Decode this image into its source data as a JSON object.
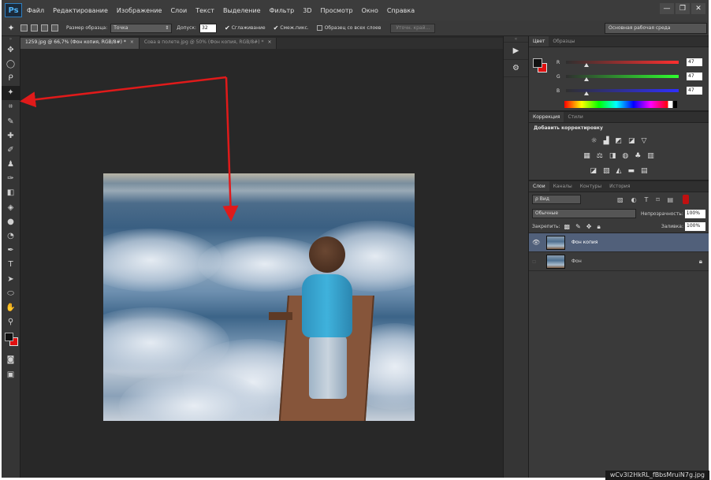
{
  "app": {
    "logo": "Ps",
    "menu": [
      "Файл",
      "Редактирование",
      "Изображение",
      "Слои",
      "Текст",
      "Выделение",
      "Фильтр",
      "3D",
      "Просмотр",
      "Окно",
      "Справка"
    ],
    "window_controls": {
      "minimize": "—",
      "restore": "❐",
      "close": "✕"
    }
  },
  "options_bar": {
    "tool_icon": "magic-wand-icon",
    "sample_size_label": "Размер образца:",
    "sample_size_value": "Точка",
    "tolerance_label": "Допуск:",
    "tolerance_value": "32",
    "antialias_label": "Сглаживание",
    "contiguous_label": "Смеж.пикс.",
    "all_layers_label": "Образец со всех слоев",
    "refine_edge_label": "Уточн. край...",
    "workspace_label": "Основная рабочая среда"
  },
  "doc_tabs": [
    {
      "label": "1259.jpg @ 66,7% (Фон копия, RGB/8#) *",
      "active": true
    },
    {
      "label": "Сова в полете.jpg @ 50% (Фон копия, RGB/8#) *",
      "active": false
    }
  ],
  "colors": {
    "foreground": "#111111",
    "background": "#e01010",
    "arrow": "#e01a1a"
  },
  "color_panel": {
    "tabs": [
      "Цвет",
      "Образцы"
    ],
    "sliders": [
      {
        "label": "R",
        "value": "47",
        "fraction": 0.18
      },
      {
        "label": "G",
        "value": "47",
        "fraction": 0.18
      },
      {
        "label": "B",
        "value": "47",
        "fraction": 0.18
      }
    ]
  },
  "adjustments_panel": {
    "tabs": [
      "Коррекция",
      "Стили"
    ],
    "title": "Добавить корректировку"
  },
  "layers_panel": {
    "tabs": [
      "Слои",
      "Каналы",
      "Контуры",
      "История"
    ],
    "kind_label": "ρ Вид",
    "blend_mode": "Обычные",
    "opacity_label": "Непрозрачность:",
    "opacity_value": "100%",
    "lock_label": "Закрепить:",
    "fill_label": "Заливка:",
    "fill_value": "100%",
    "layers": [
      {
        "name": "Фон копия",
        "selected": true,
        "visible": true,
        "locked": false
      },
      {
        "name": "Фон",
        "selected": false,
        "visible": false,
        "locked": true
      }
    ]
  },
  "watermark": "wCv3I2HkRL_fBbsMruiN7g.jpg"
}
